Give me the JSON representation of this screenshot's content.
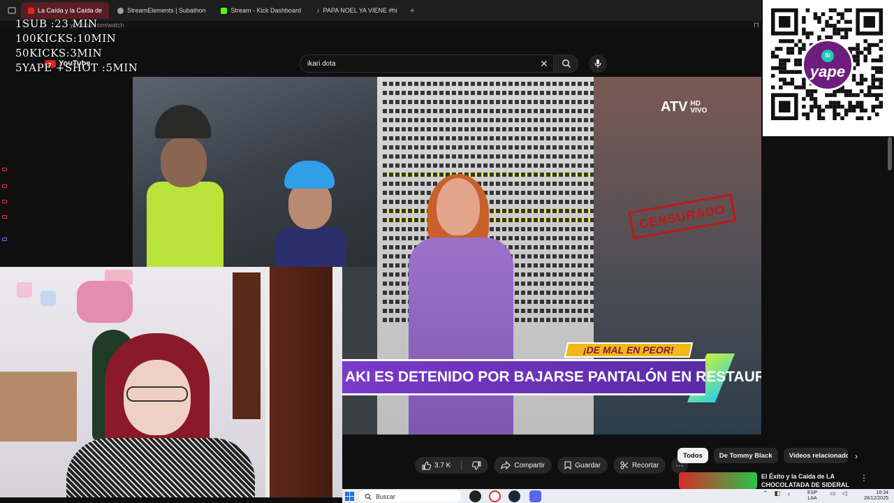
{
  "browser": {
    "tabs": [
      {
        "label": "La Caída y la Caída de",
        "color": "#e62117",
        "active": true
      },
      {
        "label": "StreamElements | Subathon",
        "color": "#9aa0a6",
        "active": false
      },
      {
        "label": "Stream - Kick Dashboard",
        "color": "#53fc18",
        "active": false
      },
      {
        "label": "PAPA NOEL YA VIENE #hi",
        "color": "#ffffff",
        "active": false
      }
    ],
    "new_tab": "+",
    "url": "youtube.com/watch"
  },
  "stream_goals": [
    "1SUB :23 MIN",
    "100KICKS:10MIN",
    "50KICKS:3MIN",
    "5YAPE +SHOT :5MIN"
  ],
  "youtube": {
    "logo_text": "YouTube",
    "search_value": "ikari dota",
    "clear": "✕",
    "actions": {
      "likes": "3.7 K",
      "share": "Compartir",
      "save": "Guardar",
      "clip": "Recortar",
      "more": "···"
    },
    "chips": [
      {
        "label": "Todos",
        "active": true
      },
      {
        "label": "De Tommy Black",
        "active": false
      },
      {
        "label": "Videos relacionados",
        "active": false
      }
    ],
    "chip_next": "›",
    "recommended": {
      "title": "El Éxito y la Caída de LA CHOCOLATADA DE SIDERAL",
      "menu": "⋮"
    }
  },
  "video": {
    "channel_logo": "ATV",
    "channel_hd": "HD",
    "channel_vivo": "VIVO",
    "stamp": "CENSURADO",
    "kicker": "¡DE MAL EN PEOR!",
    "headline": "AKI ES DETENIDO POR BAJARSE PANTALÓN EN RESTAURANTE"
  },
  "qr": {
    "brand": "yape",
    "coin": "S/"
  },
  "taskbar": {
    "search_placeholder": "Buscar",
    "lang_top": "ESP",
    "lang_bottom": "LAA",
    "time": "16:34",
    "date": "26/12/2025"
  },
  "colors": {
    "youtube_red": "#e62117",
    "yape_purple": "#6d1e7d",
    "banner_purple": "#7a3ac8",
    "banner_yellow": "#f3b81a"
  }
}
